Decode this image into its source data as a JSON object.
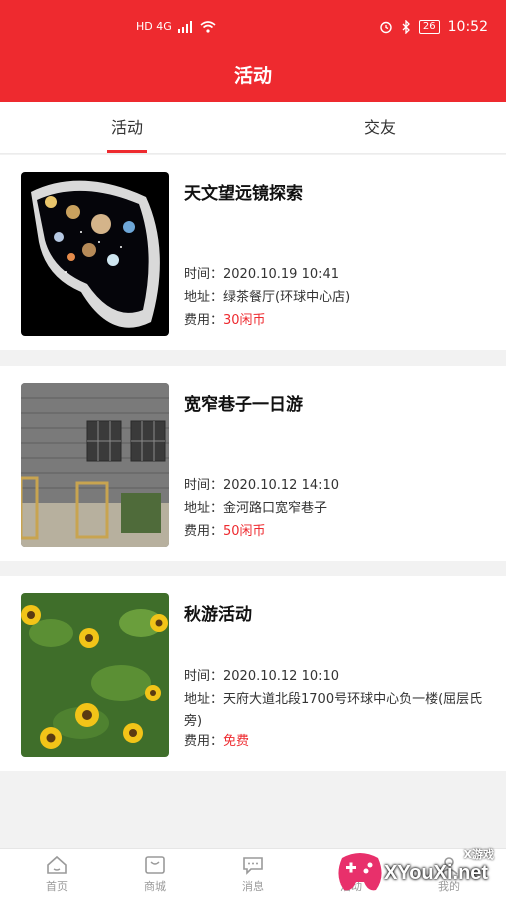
{
  "status_bar": {
    "left_text": "HD 4G",
    "time": "10:52",
    "battery": "26"
  },
  "header": {
    "title": "活动"
  },
  "tabs": [
    {
      "label": "活动",
      "active": true
    },
    {
      "label": "交友",
      "active": false
    }
  ],
  "labels": {
    "time": "时间：",
    "address": "地址：",
    "fee": "费用："
  },
  "events": [
    {
      "title": "天文望远镜探索",
      "time": "2020.10.19 10:41",
      "address": "绿茶餐厅(环球中心店)",
      "fee": "30闲币"
    },
    {
      "title": "宽窄巷子一日游",
      "time": "2020.10.12 14:10",
      "address": "金河路口宽窄巷子",
      "fee": "50闲币"
    },
    {
      "title": "秋游活动",
      "time": "2020.10.12 10:10",
      "address": "天府大道北段1700号环球中心负一楼(屈层氏旁)",
      "fee": "免费"
    }
  ],
  "bottom_nav": [
    {
      "label": "首页",
      "icon": "home-icon"
    },
    {
      "label": "商城",
      "icon": "shop-icon"
    },
    {
      "label": "消息",
      "icon": "message-icon"
    },
    {
      "label": "活动",
      "icon": "activity-icon"
    },
    {
      "label": "我的",
      "icon": "user-icon"
    }
  ],
  "watermark": {
    "text": "XYouXi.net",
    "sub": "X游戏"
  },
  "colors": {
    "primary": "#ee2a2f",
    "fee": "#ee2a2f",
    "background": "#f2f2f2"
  }
}
